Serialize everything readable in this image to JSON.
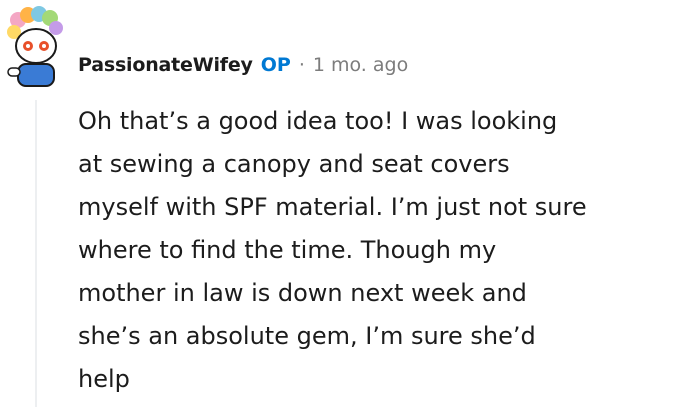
{
  "comment": {
    "author": "PassionateWifey",
    "op_badge": "OP",
    "separator": "·",
    "timestamp": "1 mo. ago",
    "body_lines": [
      "Oh that’s a good idea too! I was looking",
      "at sewing a canopy and seat covers",
      "myself with SPF material. I’m just not sure",
      "where to find the time. Though my",
      "mother in law is down next week and",
      "she’s an absolute gem, I’m sure she’d",
      "help"
    ]
  },
  "icons": {
    "avatar": "snoo-avatar-icon"
  },
  "colors": {
    "op_badge": "#0079d3",
    "meta_text": "#7c7c7c",
    "thread_line": "#edeff1",
    "body_text": "#1c1c1c"
  }
}
